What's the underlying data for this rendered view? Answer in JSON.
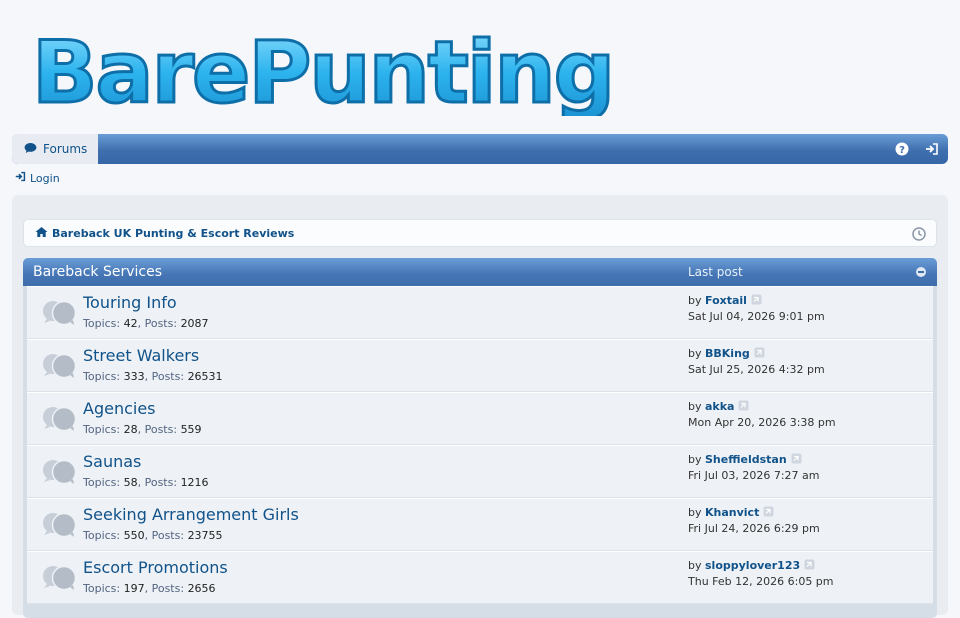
{
  "site": {
    "logo_text": "BarePunting"
  },
  "navbar": {
    "forums_label": "Forums",
    "help_icon": "question-circle-icon",
    "login_icon": "sign-in-icon"
  },
  "login_label": "Login",
  "breadcrumb": {
    "label": "Bareback UK Punting & Escort Reviews"
  },
  "category": {
    "title": "Bareback Services",
    "last_post_header": "Last post"
  },
  "labels": {
    "topics": "Topics:",
    "posts": "Posts:",
    "by": "by"
  },
  "forums": [
    {
      "title": "Touring Info",
      "topics": "42",
      "posts": "2087",
      "last_user": "Foxtail",
      "last_date": "Sat Jul 04, 2026 9:01 pm"
    },
    {
      "title": "Street Walkers",
      "topics": "333",
      "posts": "26531",
      "last_user": "BBKing",
      "last_date": "Sat Jul 25, 2026 4:32 pm"
    },
    {
      "title": "Agencies",
      "topics": "28",
      "posts": "559",
      "last_user": "akka",
      "last_date": "Mon Apr 20, 2026 3:38 pm"
    },
    {
      "title": "Saunas",
      "topics": "58",
      "posts": "1216",
      "last_user": "Sheffieldstan",
      "last_date": "Fri Jul 03, 2026 7:27 am"
    },
    {
      "title": "Seeking Arrangement Girls",
      "topics": "550",
      "posts": "23755",
      "last_user": "Khanvict",
      "last_date": "Fri Jul 24, 2026 6:29 pm"
    },
    {
      "title": "Escort Promotions",
      "topics": "197",
      "posts": "2656",
      "last_user": "sloppylover123",
      "last_date": "Thu Feb 12, 2026 6:05 pm"
    }
  ],
  "colors": {
    "accent": "#4575b4",
    "link": "#105289",
    "logo": "#3bb8ee"
  }
}
